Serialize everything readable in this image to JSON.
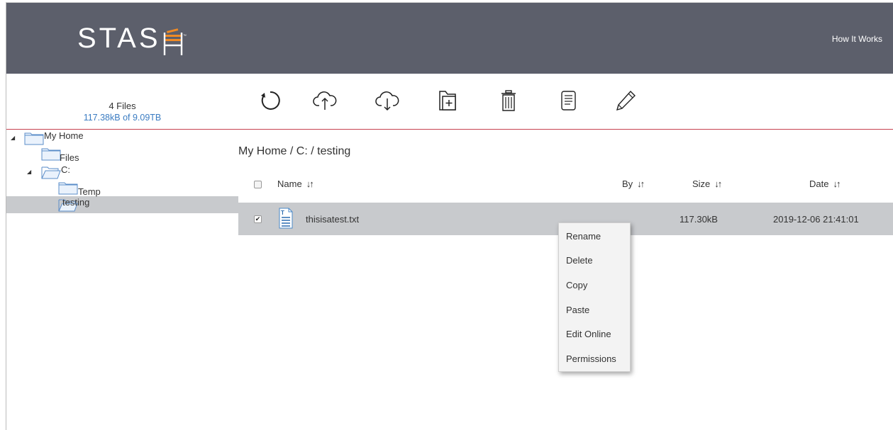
{
  "app": {
    "logo": "STAS",
    "how_it_works": "How It Works"
  },
  "stats": {
    "files": "4 Files",
    "usage": "117.38kB of 9.09TB"
  },
  "toolbar": [
    "refresh-icon",
    "upload-icon",
    "download-icon",
    "new-folder-icon",
    "delete-icon",
    "properties-icon",
    "edit-icon"
  ],
  "tree": {
    "root": "My Home",
    "files": "Files",
    "drive": "C:",
    "temp": "Temp",
    "testing": "testing"
  },
  "breadcrumb": "My Home /  C: /  testing",
  "columns": {
    "name": "Name",
    "by": "By",
    "size": "Size",
    "date": "Date",
    "sort_glyph": "↓↑"
  },
  "rows": [
    {
      "name": "thisisatest.txt",
      "by": "",
      "size": "117.30kB",
      "date": "2019-12-06 21:41:01",
      "checked": true
    }
  ],
  "context_menu": [
    "Rename",
    "Delete",
    "Copy",
    "Paste",
    "Edit Online",
    "Permissions"
  ],
  "colors": {
    "header": "#5c5f6b",
    "accent": "#f08a24",
    "link": "#3b7cc2",
    "selection": "#c8cacd",
    "divider": "#c7414f"
  }
}
